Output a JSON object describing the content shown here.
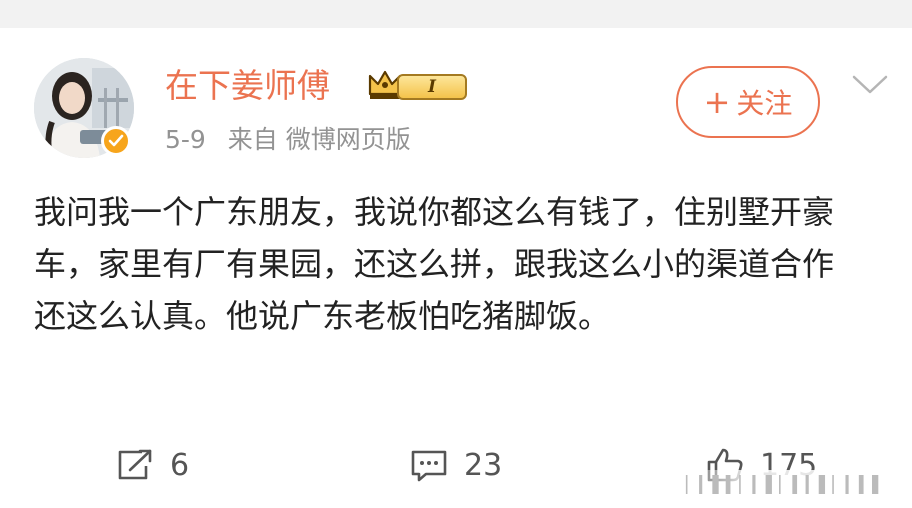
{
  "post": {
    "username": "在下姜师傅",
    "vip_level": "I",
    "date": "5-9",
    "source": "来自 微博网页版",
    "follow_label": "关注",
    "text": "我问我一个广东朋友，我说你都这么有钱了，住别墅开豪车，家里有厂有果园，还这么拼，跟我这么小的渠道合作还这么认真。他说广东老板怕吃猪脚饭。"
  },
  "actions": {
    "repost_count": "6",
    "comment_count": "23",
    "like_count": "175"
  },
  "icons": {
    "verified": "verified-badge-icon",
    "crown": "crown-icon",
    "more": "chevron-down-icon",
    "repost": "repost-icon",
    "comment": "comment-icon",
    "like": "thumbs-up-icon"
  },
  "colors": {
    "accent": "#eb7350",
    "verified": "#f7a51c",
    "meta_text": "#939393",
    "body_text": "#222222"
  }
}
